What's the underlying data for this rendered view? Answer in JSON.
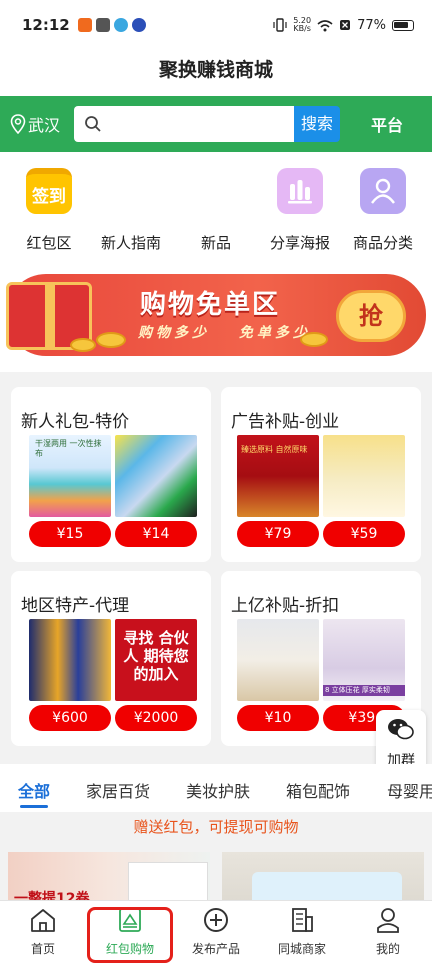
{
  "status_bar": {
    "time": "12:12",
    "net_speed_value": "5.20",
    "net_speed_unit": "KB/s",
    "battery": "77%"
  },
  "header": {
    "title": "聚换赚钱商城"
  },
  "search_bar": {
    "city": "武汉",
    "search_placeholder": "",
    "search_button": "搜索",
    "platform_button": "平台"
  },
  "quick_menu": [
    {
      "label": "红包区",
      "icon_text": "签到",
      "icon": "sign-in-calendar-icon"
    },
    {
      "label": "新人指南",
      "icon": "blank-icon"
    },
    {
      "label": "新品",
      "icon": "blank-icon"
    },
    {
      "label": "分享海报",
      "icon": "bar-chart-icon"
    },
    {
      "label": "商品分类",
      "icon": "user-share-icon"
    }
  ],
  "banner": {
    "title": "购物免单区",
    "subtitle_left": "购物多少",
    "subtitle_right": "免单多少",
    "badge": "抢"
  },
  "cards": [
    {
      "title": "新人礼包-特价",
      "items": [
        {
          "price": "¥15",
          "image_text": "干湿两用 一次性抹布"
        },
        {
          "price": "¥14",
          "image_text": ""
        }
      ]
    },
    {
      "title": "广告补贴-创业",
      "items": [
        {
          "price": "¥79",
          "image_text": "臻选原料 自然原味"
        },
        {
          "price": "¥59",
          "image_text": ""
        }
      ]
    },
    {
      "title": "地区特产-代理",
      "items": [
        {
          "price": "¥600",
          "image_text": ""
        },
        {
          "price": "¥2000",
          "image_text": "寻找 合伙人 期待您的加入"
        }
      ]
    },
    {
      "title": "上亿补贴-折扣",
      "items": [
        {
          "price": "¥10",
          "image_text": ""
        },
        {
          "price": "¥39.",
          "image_text": "8 立体压花 厚实柔韧"
        }
      ]
    }
  ],
  "wechat_float": {
    "label": "加群"
  },
  "category_tabs": [
    "全部",
    "家居百货",
    "美妆护肤",
    "箱包配饰",
    "母婴用"
  ],
  "promo_text": "赠送红包，可提现可购物",
  "feed": [
    {
      "image_text": "一整提12卷"
    },
    {
      "image_text": ""
    }
  ],
  "bottom_nav": [
    {
      "label": "首页",
      "icon": "home-icon"
    },
    {
      "label": "红包购物",
      "icon": "red-packet-icon"
    },
    {
      "label": "发布产品",
      "icon": "plus-circle-icon"
    },
    {
      "label": "同城商家",
      "icon": "building-icon"
    },
    {
      "label": "我的",
      "icon": "person-icon"
    }
  ],
  "colors": {
    "accent_green": "#2eaa57",
    "search_blue": "#1b8fe8",
    "price_red": "#f00000",
    "tab_active": "#1b6fd8",
    "promo_orange": "#e8541c",
    "highlight_red": "#e4201a"
  }
}
